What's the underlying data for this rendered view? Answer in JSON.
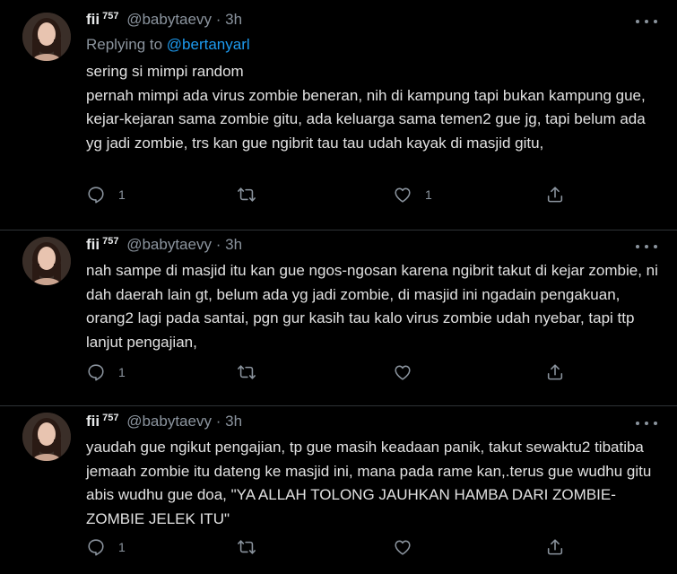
{
  "tweets": [
    {
      "name": "fii",
      "badge": "757",
      "handle": "@babytaevy",
      "dot": "·",
      "time": "3h",
      "reply_prefix": "Replying to",
      "reply_mention": "@bertanyarl",
      "text": "sering si mimpi random\npernah mimpi ada virus zombie beneran, nih di kampung tapi bukan kampung gue, kejar-kejaran sama zombie gitu, ada keluarga sama temen2 gue jg, tapi belum ada yg jadi zombie, trs kan gue ngibrit tau tau udah kayak di masjid gitu,",
      "reply_count": "1",
      "retweet_count": "",
      "like_count": "1"
    },
    {
      "name": "fii",
      "badge": "757",
      "handle": "@babytaevy",
      "dot": "·",
      "time": "3h",
      "text": "nah sampe di masjid itu kan gue ngos-ngosan karena ngibrit takut di kejar zombie, ni dah daerah lain gt, belum ada yg jadi zombie, di masjid ini ngadain pengakuan, orang2 lagi pada santai, pgn gur kasih tau kalo virus zombie udah nyebar, tapi ttp lanjut pengajian,",
      "reply_count": "1",
      "retweet_count": "",
      "like_count": ""
    },
    {
      "name": "fii",
      "badge": "757",
      "handle": "@babytaevy",
      "dot": "·",
      "time": "3h",
      "text": "yaudah gue ngikut pengajian, tp gue masih keadaan panik, takut sewaktu2 tibatiba jemaah zombie itu dateng ke masjid ini, mana pada rame kan,.terus gue wudhu gitu abis wudhu gue doa, \"YA  ALLAH TOLONG JAUHKAN HAMBA DARI ZOMBIE-ZOMBIE JELEK ITU\"",
      "reply_count": "1",
      "retweet_count": "",
      "like_count": ""
    }
  ],
  "icons": {
    "reply": "reply-icon",
    "retweet": "retweet-icon",
    "like": "heart-icon",
    "share": "share-icon",
    "more": "more-icon"
  },
  "colors": {
    "background": "#000000",
    "text": "#e1e1e1",
    "secondary": "#8b949e",
    "link": "#1d9bf0",
    "divider": "#2f3336"
  }
}
